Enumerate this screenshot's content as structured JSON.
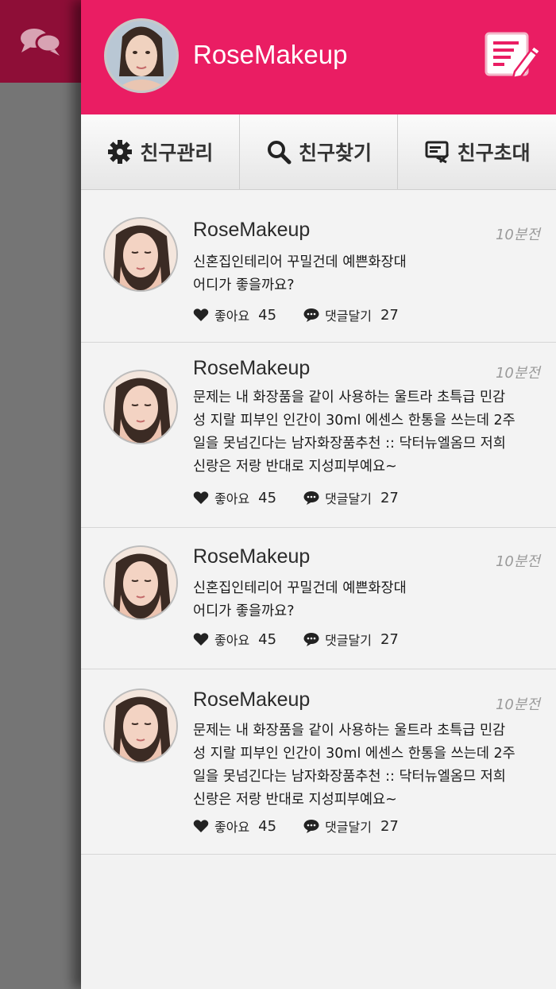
{
  "header": {
    "title": "RoseMakeup"
  },
  "tabs": [
    {
      "label": "친구관리",
      "icon": "gear-icon"
    },
    {
      "label": "친구찾기",
      "icon": "search-icon"
    },
    {
      "label": "친구초대",
      "icon": "invite-icon"
    }
  ],
  "posts": [
    {
      "author": "RoseMakeup",
      "time": "10분전",
      "text": [
        "신혼집인테리어 꾸밀건데 예쁜화장대",
        "어디가 좋을까요?"
      ],
      "like_label": "좋아요",
      "like_count": "45",
      "comment_label": "댓글달기",
      "comment_count": "27"
    },
    {
      "author": "RoseMakeup",
      "time": "10분전",
      "text": [
        "문제는 내 화장품을 같이 사용하는 울트라 초특급 민감",
        "성 지랄 피부인 인간이 30ml 에센스 한통을 쓰는데 2주",
        "일을 못넘긴다는 남자화장품추천 :: 닥터뉴엘옴므 저희",
        "신랑은 저랑 반대로 지성피부예요~"
      ],
      "like_label": "좋아요",
      "like_count": "45",
      "comment_label": "댓글달기",
      "comment_count": "27"
    },
    {
      "author": "RoseMakeup",
      "time": "10분전",
      "text": [
        "신혼집인테리어 꾸밀건데 예쁜화장대",
        "어디가 좋을까요?"
      ],
      "like_label": "좋아요",
      "like_count": "45",
      "comment_label": "댓글달기",
      "comment_count": "27"
    },
    {
      "author": "RoseMakeup",
      "time": "10분전",
      "text": [
        "문제는 내 화장품을 같이 사용하는 울트라 초특급 민감",
        "성 지랄 피부인 인간이 30ml 에센스 한통을 쓰는데 2주",
        "일을 못넘긴다는 남자화장품추천 :: 닥터뉴엘옴므 저희",
        "신랑은 저랑 반대로 지성피부예요~"
      ],
      "like_label": "좋아요",
      "like_count": "45",
      "comment_label": "댓글달기",
      "comment_count": "27"
    }
  ],
  "colors": {
    "brand": "#ea1d63",
    "sidebar_top": "#8e0e37"
  }
}
